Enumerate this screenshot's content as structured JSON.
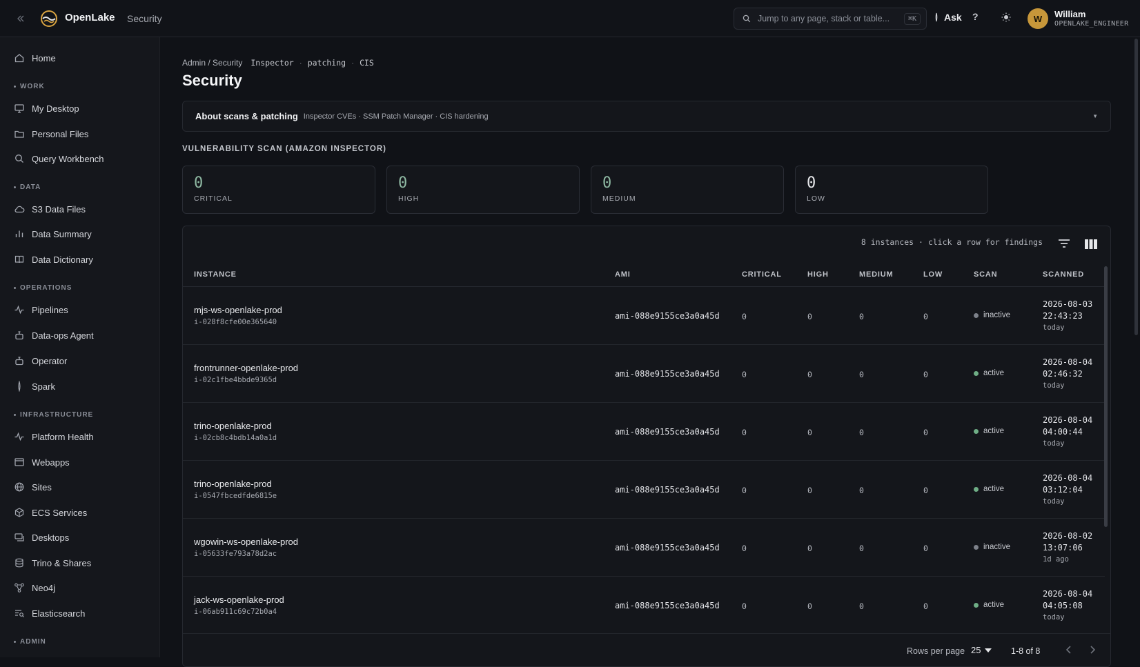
{
  "topbar": {
    "brand": "OpenLake",
    "section": "Security",
    "search_placeholder": "Jump to any page, stack or table...",
    "search_shortcut": "⌘K",
    "ask_label": "Ask",
    "help_label": "?",
    "user_initial": "W",
    "user_name": "William",
    "user_role": "OPENLAKE_ENGINEER"
  },
  "sidebar": {
    "home": "Home",
    "groups": {
      "work": "WORK",
      "data": "DATA",
      "operations": "OPERATIONS",
      "infrastructure": "INFRASTRUCTURE",
      "admin": "ADMIN"
    },
    "items": {
      "my_desktop": "My Desktop",
      "personal_files": "Personal Files",
      "query_workbench": "Query Workbench",
      "s3_data_files": "S3 Data Files",
      "data_summary": "Data Summary",
      "data_dictionary": "Data Dictionary",
      "pipelines": "Pipelines",
      "data_ops_agent": "Data-ops Agent",
      "operator": "Operator",
      "spark": "Spark",
      "platform_health": "Platform Health",
      "webapps": "Webapps",
      "sites": "Sites",
      "ecs_services": "ECS Services",
      "desktops": "Desktops",
      "trino_shares": "Trino & Shares",
      "neo4j": "Neo4j",
      "elasticsearch": "Elasticsearch"
    }
  },
  "breadcrumb": {
    "path": "Admin / Security",
    "tags": [
      "Inspector",
      "patching",
      "CIS"
    ],
    "separator": "·"
  },
  "page": {
    "title": "Security",
    "about_title": "About scans & patching",
    "about_subtitle": "Inspector CVEs · SSM Patch Manager · CIS hardening",
    "section_label": "VULNERABILITY SCAN (AMAZON INSPECTOR)"
  },
  "stats": [
    {
      "value": "0",
      "label": "CRITICAL"
    },
    {
      "value": "0",
      "label": "HIGH"
    },
    {
      "value": "0",
      "label": "MEDIUM"
    },
    {
      "value": "0",
      "label": "LOW"
    }
  ],
  "table": {
    "info": "8 instances · click a row for findings",
    "columns": [
      "INSTANCE",
      "AMI",
      "CRITICAL",
      "HIGH",
      "MEDIUM",
      "LOW",
      "SCAN",
      "SCANNED"
    ],
    "rows": [
      {
        "name": "mjs-ws-openlake-prod",
        "id": "i-028f8cfe00e365640",
        "ami": "ami-088e9155ce3a0a45d",
        "critical": "0",
        "high": "0",
        "medium": "0",
        "low": "0",
        "scan": "inactive",
        "date": "2026-08-03",
        "time": "22:43:23",
        "rel": "today"
      },
      {
        "name": "frontrunner-openlake-prod",
        "id": "i-02c1fbe4bbde9365d",
        "ami": "ami-088e9155ce3a0a45d",
        "critical": "0",
        "high": "0",
        "medium": "0",
        "low": "0",
        "scan": "active",
        "date": "2026-08-04",
        "time": "02:46:32",
        "rel": "today"
      },
      {
        "name": "trino-openlake-prod",
        "id": "i-02cb8c4bdb14a0a1d",
        "ami": "ami-088e9155ce3a0a45d",
        "critical": "0",
        "high": "0",
        "medium": "0",
        "low": "0",
        "scan": "active",
        "date": "2026-08-04",
        "time": "04:00:44",
        "rel": "today"
      },
      {
        "name": "trino-openlake-prod",
        "id": "i-0547fbcedfde6815e",
        "ami": "ami-088e9155ce3a0a45d",
        "critical": "0",
        "high": "0",
        "medium": "0",
        "low": "0",
        "scan": "active",
        "date": "2026-08-04",
        "time": "03:12:04",
        "rel": "today"
      },
      {
        "name": "wgowin-ws-openlake-prod",
        "id": "i-05633fe793a78d2ac",
        "ami": "ami-088e9155ce3a0a45d",
        "critical": "0",
        "high": "0",
        "medium": "0",
        "low": "0",
        "scan": "inactive",
        "date": "2026-08-02",
        "time": "13:07:06",
        "rel": "1d ago"
      },
      {
        "name": "jack-ws-openlake-prod",
        "id": "i-06ab911c69c72b0a4",
        "ami": "ami-088e9155ce3a0a45d",
        "critical": "0",
        "high": "0",
        "medium": "0",
        "low": "0",
        "scan": "active",
        "date": "2026-08-04",
        "time": "04:05:08",
        "rel": "today"
      }
    ],
    "rows_per_page_label": "Rows per page",
    "rows_per_page": "25",
    "range": "1-8 of 8"
  },
  "colors": {
    "active": "#6fae86",
    "inactive": "#7d818a",
    "stat_value": "#8fb9a3",
    "avatar": "#c7973a"
  }
}
